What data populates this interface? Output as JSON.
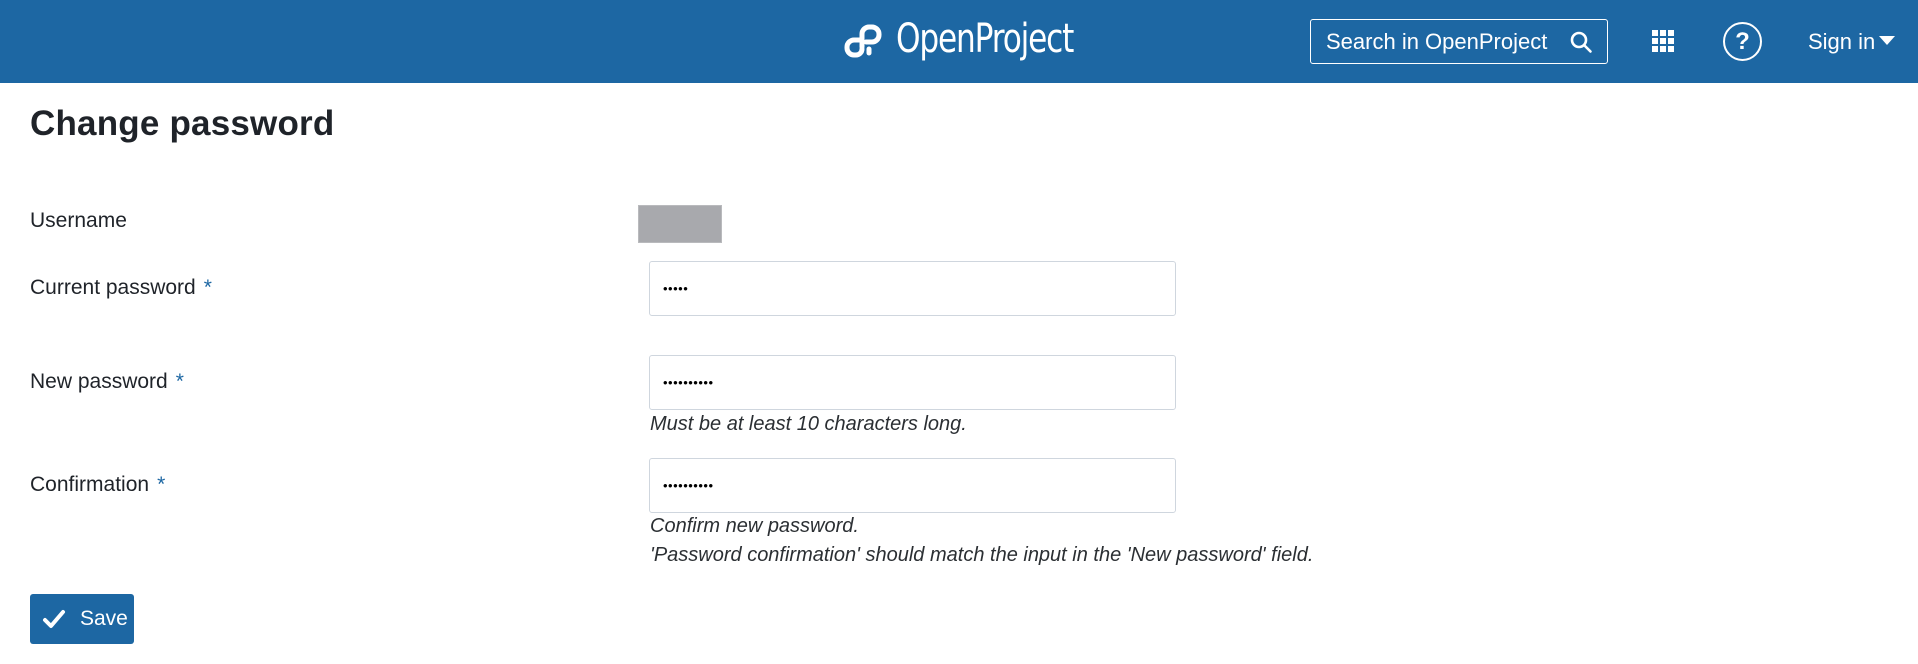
{
  "header": {
    "logo_text": "OpenProject",
    "search_placeholder": "Search in OpenProject",
    "search_icon": "search-icon",
    "modules_icon": "grid-icon",
    "help_icon": "help-icon",
    "help_glyph": "?",
    "signin_label": "Sign in",
    "signin_icon": "caret-down-icon",
    "brand_color": "#1d67a3"
  },
  "page": {
    "title": "Change password"
  },
  "form": {
    "fields": [
      {
        "label": "Username",
        "required": false,
        "value_redacted": true
      },
      {
        "label": "Current password",
        "required": true,
        "value": "•••••"
      },
      {
        "label": "New password",
        "required": true,
        "value": "••••••••••",
        "hints": [
          "Must be at least 10 characters long."
        ]
      },
      {
        "label": "Confirmation",
        "required": true,
        "value": "••••••••••",
        "hints": [
          "Confirm new password.",
          "'Password confirmation' should match the input in the 'New password' field."
        ]
      }
    ],
    "required_marker": "*",
    "save_label": "Save",
    "save_icon": "check-icon"
  }
}
